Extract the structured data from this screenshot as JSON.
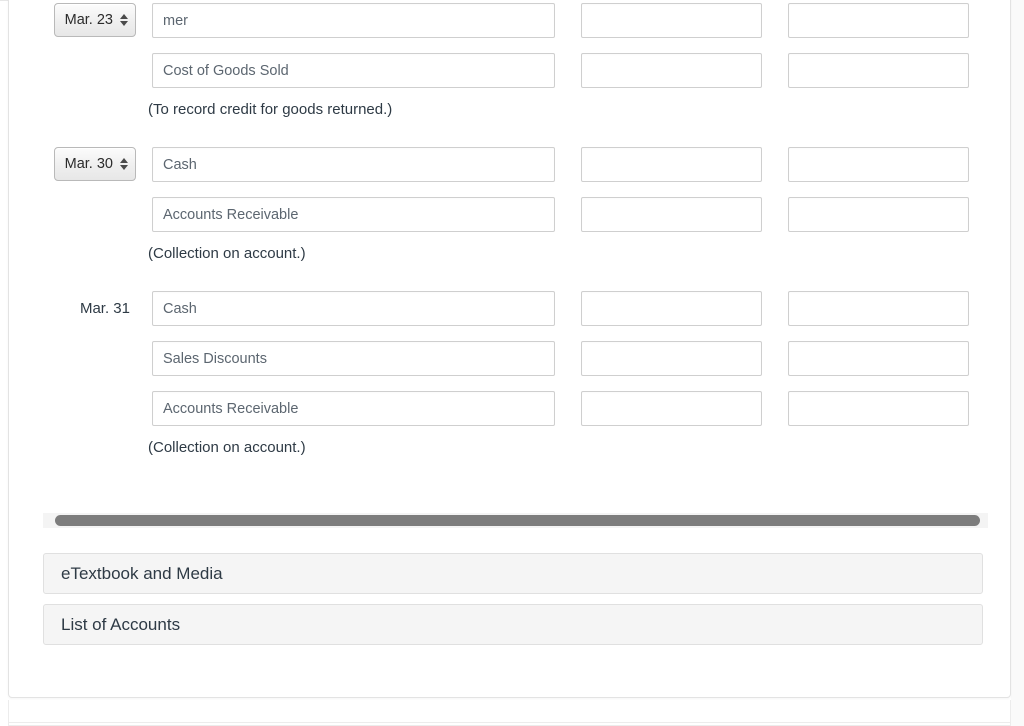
{
  "journal": {
    "entries": [
      {
        "date": {
          "type": "select",
          "value": "Mar. 23"
        },
        "lines": [
          {
            "account": "mer",
            "debit": "",
            "credit": ""
          },
          {
            "account": "Cost of Goods Sold",
            "debit": "",
            "credit": ""
          }
        ],
        "explanation": "(To record credit for goods returned.)"
      },
      {
        "date": {
          "type": "select",
          "value": "Mar. 30"
        },
        "lines": [
          {
            "account": "Cash",
            "debit": "",
            "credit": ""
          },
          {
            "account": "Accounts Receivable",
            "debit": "",
            "credit": ""
          }
        ],
        "explanation": "(Collection on account.)"
      },
      {
        "date": {
          "type": "text",
          "value": "Mar. 31"
        },
        "lines": [
          {
            "account": "Cash",
            "debit": "",
            "credit": ""
          },
          {
            "account": "Sales Discounts",
            "debit": "",
            "credit": ""
          },
          {
            "account": "Accounts Receivable",
            "debit": "",
            "credit": ""
          }
        ],
        "explanation": "(Collection on account.)"
      }
    ]
  },
  "scrollbar": {
    "orientation": "horizontal",
    "thumb_name": "horizontal-scrollbar-thumb"
  },
  "accordions": [
    {
      "id": "etextbook",
      "label": "eTextbook and Media",
      "expanded": false
    },
    {
      "id": "accounts",
      "label": "List of Accounts",
      "expanded": false
    }
  ],
  "colors": {
    "field_border": "#cfcfcf",
    "field_text": "#5c6670",
    "body_text": "#2e3a45",
    "accordion_bg": "#f5f5f5",
    "accordion_border": "#e0e0e0",
    "scroll_thumb": "#7d7d7d",
    "card_border": "#e3e3e3"
  }
}
